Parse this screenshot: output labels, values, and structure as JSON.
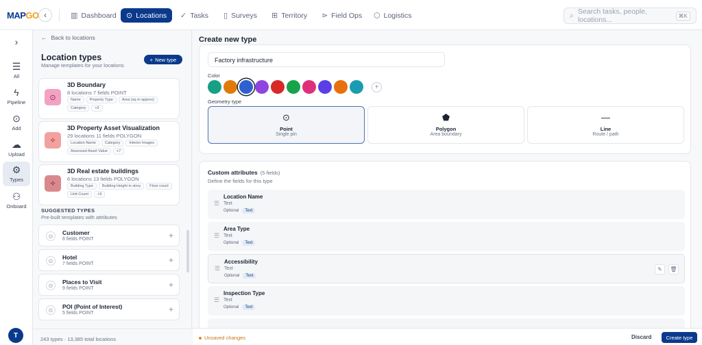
{
  "app": {
    "logo_main": "MAP",
    "logo_accent": "GO"
  },
  "nav": [
    {
      "label": "Dashboard",
      "icon": "bar-chart-icon",
      "active": false
    },
    {
      "label": "Locations",
      "icon": "map-pin-icon",
      "active": true
    },
    {
      "label": "Tasks",
      "icon": "check-icon",
      "active": false
    },
    {
      "label": "Surveys",
      "icon": "clipboard-icon",
      "active": false
    },
    {
      "label": "Territory",
      "icon": "map-icon",
      "active": false
    },
    {
      "label": "Field Ops",
      "icon": "route-icon",
      "active": false
    },
    {
      "label": "Logistics",
      "icon": "box-icon",
      "active": false
    }
  ],
  "search": {
    "placeholder": "Search tasks, people, locations...",
    "shortcut": "⌘K"
  },
  "rail": [
    {
      "label": "",
      "icon": "chevron-right-icon"
    },
    {
      "label": "All",
      "icon": "list-icon"
    },
    {
      "label": "Pipeline",
      "icon": "bolt-icon"
    },
    {
      "label": "Add",
      "icon": "map-pin-icon"
    },
    {
      "label": "Upload",
      "icon": "upload-icon"
    },
    {
      "label": "Types",
      "icon": "gear-icon",
      "active": true
    },
    {
      "label": "Onboard",
      "icon": "user-add-icon"
    }
  ],
  "user": {
    "initial": "T"
  },
  "left": {
    "back_label": "Back to locations",
    "title": "Location types",
    "subtitle": "Manage templates for your locations",
    "new_button": "New type",
    "types": [
      {
        "name": "3D Boundary",
        "meta": "8 locations  7 fields  POINT",
        "tags": [
          "Name",
          "Property Type",
          "Area (sq m approx)",
          "Category",
          "+3"
        ],
        "color": "#f2a3c4",
        "icon_color": "#9b1f5a",
        "icon": "map-pin-icon"
      },
      {
        "name": "3D Property Asset Visualization",
        "meta": "29 locations  11 fields  POLYGON",
        "tags": [
          "Location Name",
          "Category",
          "Interior Images",
          "Assessed Asset Value",
          "+7"
        ],
        "color": "#f2a1a1",
        "icon_color": "#a32424",
        "icon": "polygon-icon"
      },
      {
        "name": "3D Real estate buildings",
        "meta": "6 locations  13 fields  POLYGON",
        "tags": [
          "Building Type",
          "Building Height in story",
          "Floor count",
          "Unit Count",
          "+9"
        ],
        "color": "#d9898d",
        "icon_color": "#7a1f24",
        "icon": "polygon-icon"
      }
    ],
    "suggested_title": "SUGGESTED TYPES",
    "suggested_subtitle": "Pre-built templates with attributes",
    "suggested": [
      {
        "name": "Customer",
        "meta": "6 fields  POINT"
      },
      {
        "name": "Hotel",
        "meta": "7 fields  POINT"
      },
      {
        "name": "Places to Visit",
        "meta": "9 fields  POINT"
      },
      {
        "name": "POI (Point of Interest)",
        "meta": "5 fields  POINT"
      }
    ],
    "footer": "243 types · 13,385 total locations"
  },
  "main": {
    "title": "Create new type",
    "name_value": "Factory infrastructure",
    "color_label": "Color",
    "colors": [
      "#16a085",
      "#e07b0a",
      "#2f5fd0",
      "#8e44e0",
      "#d92828",
      "#19a34a",
      "#e0307a",
      "#5a3fe6",
      "#e8700e",
      "#1a9cb0"
    ],
    "selected_color": "#2f5fd0",
    "geometry_label": "Geometry type",
    "geometry": [
      {
        "name": "Point",
        "sub": "Single pin",
        "icon": "map-pin-icon",
        "selected": true
      },
      {
        "name": "Polygon",
        "sub": "Area boundary",
        "icon": "pentagon-icon",
        "selected": false
      },
      {
        "name": "Line",
        "sub": "Route / path",
        "icon": "line-icon",
        "selected": false
      }
    ],
    "attributes_title": "Custom attributes",
    "attributes_count": "(5 fields)",
    "attributes_subtitle": "Define the fields for this type",
    "attributes": [
      {
        "name": "Location Name",
        "type": "Text",
        "required": "Optional",
        "badge": "Text"
      },
      {
        "name": "Area Type",
        "type": "Text",
        "required": "Optional",
        "badge": "Text"
      },
      {
        "name": "Accessibility",
        "type": "Text",
        "required": "Optional",
        "badge": "Text",
        "hover": true
      },
      {
        "name": "Inspection Type",
        "type": "Text",
        "required": "Optional",
        "badge": "Text"
      }
    ],
    "unsaved": "Unsaved changes",
    "discard": "Discard",
    "create": "Create type"
  }
}
